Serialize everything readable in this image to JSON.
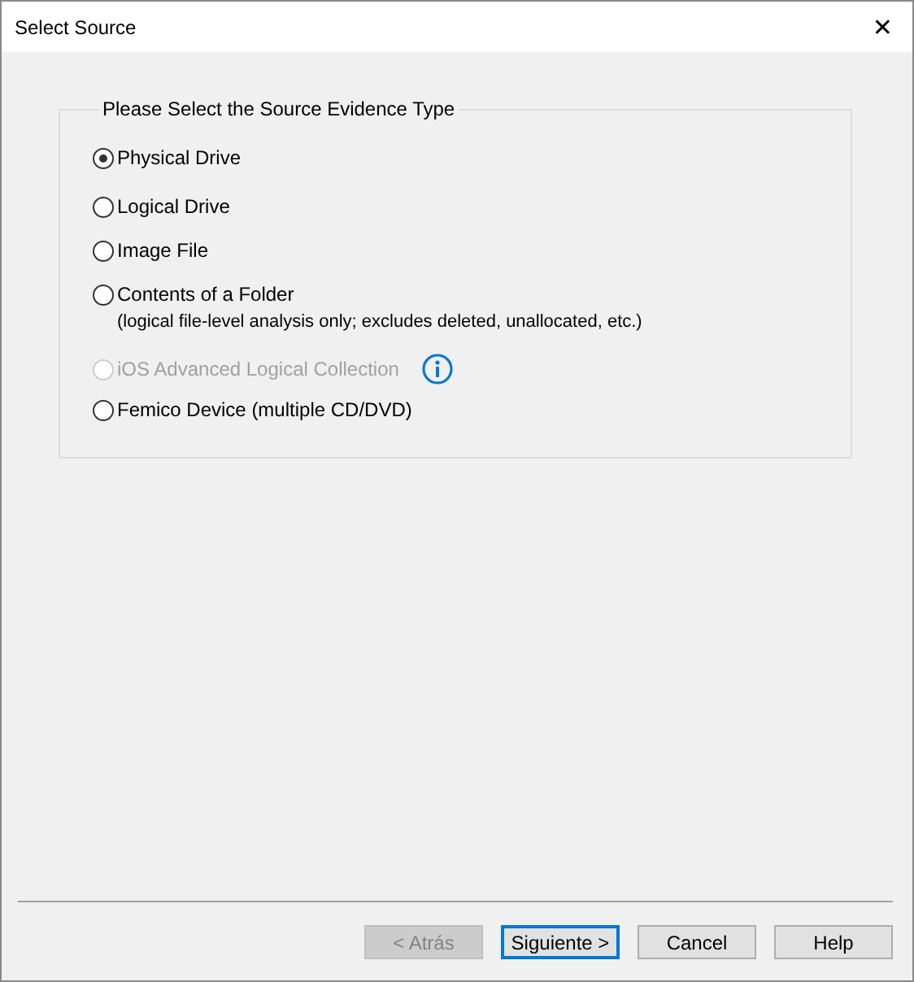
{
  "window": {
    "title": "Select Source",
    "close": "✕"
  },
  "group": {
    "title": "Please Select the Source Evidence Type",
    "options": [
      {
        "label": "Physical Drive",
        "selected": true,
        "disabled": false
      },
      {
        "label": "Logical Drive",
        "selected": false,
        "disabled": false
      },
      {
        "label": "Image File",
        "selected": false,
        "disabled": false
      },
      {
        "label": "Contents of a Folder",
        "note": "(logical file-level analysis only; excludes deleted, unallocated, etc.)",
        "selected": false,
        "disabled": false
      },
      {
        "label": "iOS Advanced Logical Collection",
        "selected": false,
        "disabled": true,
        "info": true
      },
      {
        "label": "Femico Device (multiple CD/DVD)",
        "selected": false,
        "disabled": false
      }
    ]
  },
  "buttons": [
    {
      "label": "< Atrás",
      "disabled": true,
      "default": false
    },
    {
      "label": "Siguiente >",
      "disabled": false,
      "default": true
    },
    {
      "label": "Cancel",
      "disabled": false,
      "default": false
    },
    {
      "label": "Help",
      "disabled": false,
      "default": false
    }
  ]
}
